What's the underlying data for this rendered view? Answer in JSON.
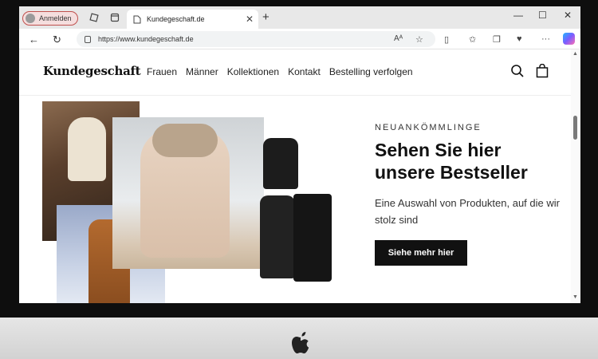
{
  "browser": {
    "profile_label": "Anmelden",
    "tab_title": "Kundegeschaft.de",
    "url": "https://www.kundegeschaft.de",
    "read_aloud_label": "Aᴬ"
  },
  "site": {
    "logo": "Kundegeschaft",
    "nav": [
      "Frauen",
      "Männer",
      "Kollektionen",
      "Kontakt",
      "Bestelling verfolgen"
    ]
  },
  "hero": {
    "eyebrow": "NEUANKÖMMLINGE",
    "headline": "Sehen Sie hier unsere Bestseller",
    "subtext": "Eine Auswahl von Produkten, auf die wir stolz sind",
    "cta_label": "Siehe mehr hier"
  },
  "colors": {
    "cta_background": "#111111",
    "profile_border": "#c0504d",
    "titlebar": "#e8e8e8"
  },
  "icons": [
    "collections-icon",
    "tab-actions-icon",
    "page-icon",
    "back-icon",
    "refresh-icon",
    "lock-icon",
    "read-aloud-icon",
    "favorite-star-icon",
    "split-screen-icon",
    "favorites-icon",
    "collections-add-icon",
    "extensions-icon",
    "more-icon",
    "copilot-icon",
    "search-icon",
    "bag-icon",
    "apple-logo-icon"
  ]
}
